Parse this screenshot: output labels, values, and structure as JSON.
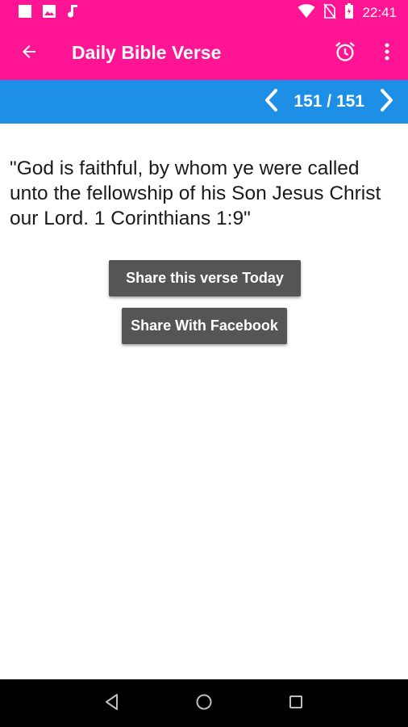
{
  "status_bar": {
    "time": "22:41",
    "icons": [
      "square-notification-icon",
      "image-icon",
      "music-note-icon",
      "wifi-icon",
      "no-sim-icon",
      "battery-icon"
    ]
  },
  "app_bar": {
    "title": "Daily Bible Verse",
    "background": "#ff1493",
    "icons": [
      "back-arrow-icon",
      "alarm-clock-icon",
      "more-vert-icon"
    ]
  },
  "pager": {
    "counter": "151 / 151",
    "background": "#1e8fe6"
  },
  "verse": {
    "text": "\"God is faithful, by whom ye were called unto the fellowship of his Son Jesus Christ our Lord. 1 Corinthians 1:9\""
  },
  "buttons": {
    "share_today": "Share this verse Today",
    "share_facebook": "Share With Facebook"
  },
  "system_nav": {
    "icons": [
      "back-triangle-icon",
      "home-circle-icon",
      "recents-square-icon"
    ]
  }
}
